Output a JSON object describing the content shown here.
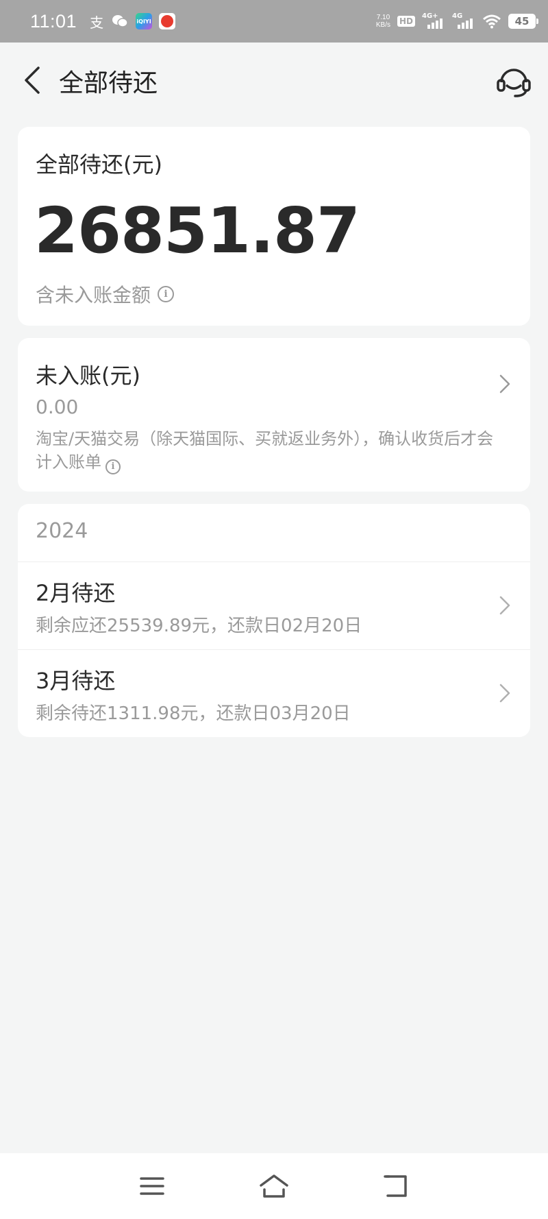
{
  "status_bar": {
    "time": "11:01",
    "net_speed_value": "7.10",
    "net_speed_unit": "KB/s",
    "hd_label": "HD",
    "signal1_label": "4G+",
    "signal2_label": "4G",
    "battery": "45",
    "icons": [
      "alipay-icon",
      "wechat-icon",
      "iqiyi-icon",
      "app-icon",
      "hd-icon",
      "signal-icon",
      "signal-icon",
      "wifi-icon",
      "battery-icon"
    ]
  },
  "header": {
    "title": "全部待还"
  },
  "total_card": {
    "label": "全部待还(元)",
    "amount": "26851.87",
    "note": "含未入账金额"
  },
  "unposted_card": {
    "label": "未入账(元)",
    "amount": "0.00",
    "description": "淘宝/天猫交易（除天猫国际、买就返业务外），确认收货后才会计入账单"
  },
  "bills": {
    "year": "2024",
    "items": [
      {
        "title": "2月待还",
        "subtitle": "剩余应还25539.89元，还款日02月20日"
      },
      {
        "title": "3月待还",
        "subtitle": "剩余待还1311.98元，还款日03月20日"
      }
    ]
  },
  "colors": {
    "background": "#f4f5f5",
    "card": "#ffffff",
    "primary_text": "#2b2b2b",
    "secondary_text": "#9a9a9a",
    "status_bar": "#a6a6a6"
  }
}
